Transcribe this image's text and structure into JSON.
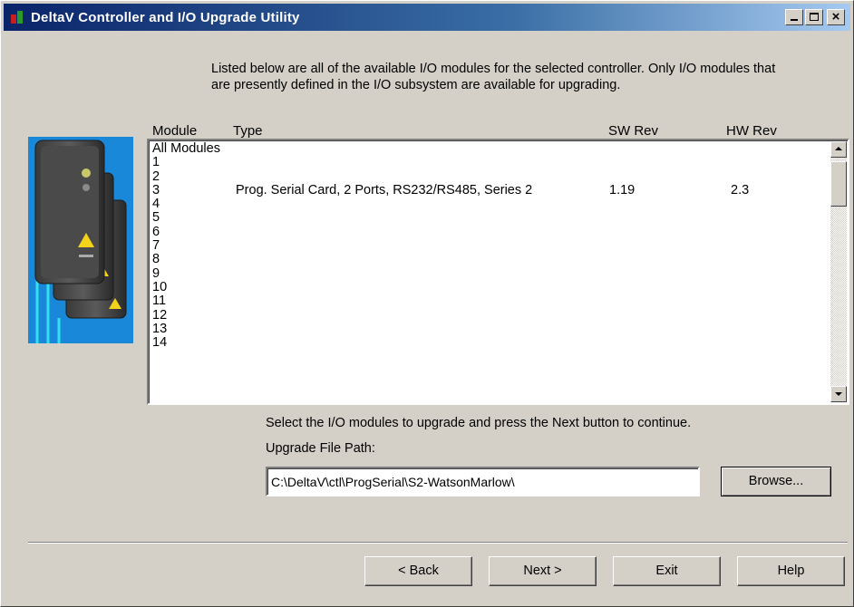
{
  "window": {
    "title": "DeltaV Controller and I/O Upgrade Utility"
  },
  "instructions": "Listed below are all of the available I/O modules for the selected controller. Only I/O modules that are presently defined in the I/O subsystem are available for upgrading.",
  "columns": {
    "module": "Module",
    "type": "Type",
    "sw_rev": "SW Rev",
    "hw_rev": "HW Rev"
  },
  "rows": [
    {
      "module": "All Modules",
      "type": "",
      "sw": "",
      "hw": ""
    },
    {
      "module": "1",
      "type": "",
      "sw": "",
      "hw": ""
    },
    {
      "module": "2",
      "type": "",
      "sw": "",
      "hw": ""
    },
    {
      "module": "3",
      "type": "Prog. Serial Card, 2 Ports, RS232/RS485, Series 2",
      "sw": "1.19",
      "hw": "2.3"
    },
    {
      "module": "4",
      "type": "",
      "sw": "",
      "hw": ""
    },
    {
      "module": "5",
      "type": "",
      "sw": "",
      "hw": ""
    },
    {
      "module": "6",
      "type": "",
      "sw": "",
      "hw": ""
    },
    {
      "module": "7",
      "type": "",
      "sw": "",
      "hw": ""
    },
    {
      "module": "8",
      "type": "",
      "sw": "",
      "hw": ""
    },
    {
      "module": "9",
      "type": "",
      "sw": "",
      "hw": ""
    },
    {
      "module": "10",
      "type": "",
      "sw": "",
      "hw": ""
    },
    {
      "module": "11",
      "type": "",
      "sw": "",
      "hw": ""
    },
    {
      "module": "12",
      "type": "",
      "sw": "",
      "hw": ""
    },
    {
      "module": "13",
      "type": "",
      "sw": "",
      "hw": ""
    },
    {
      "module": "14",
      "type": "",
      "sw": "",
      "hw": ""
    }
  ],
  "select_message": "Select the I/O modules to upgrade and press the Next button to continue.",
  "path_label": "Upgrade File Path:",
  "path_value": "C:\\DeltaV\\ctl\\ProgSerial\\S2-WatsonMarlow\\",
  "buttons": {
    "browse": "Browse...",
    "back": "< Back",
    "next": "Next >",
    "exit": "Exit",
    "help": "Help"
  },
  "icons": {
    "app": "deltav-app-icon",
    "minimize": "minimize-icon",
    "maximize": "maximize-icon",
    "close": "close-icon",
    "device": "io-card-hardware-image"
  },
  "colors": {
    "title_start": "#0a246a",
    "title_end": "#a6caf0",
    "dialog_bg": "#d4d0c8",
    "image_bg": "#1a88d8"
  }
}
